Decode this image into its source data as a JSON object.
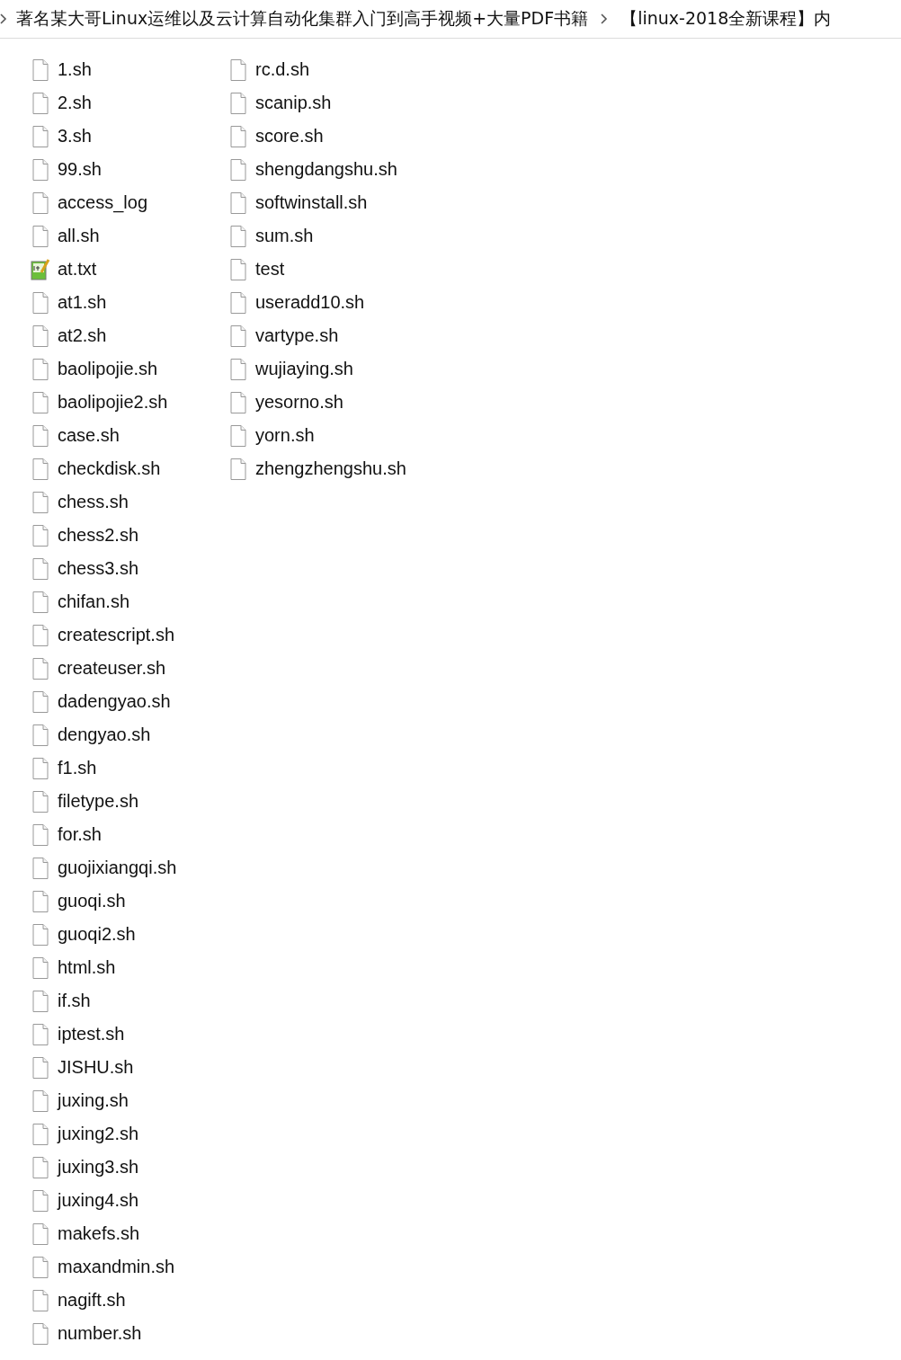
{
  "breadcrumb": [
    "著名某大哥Linux运维以及云计算自动化集群入门到高手视频+大量PDF书籍",
    "【linux-2018全新课程】内"
  ],
  "file_columns": [
    [
      {
        "name": "1.sh",
        "kind": "file"
      },
      {
        "name": "2.sh",
        "kind": "file"
      },
      {
        "name": "3.sh",
        "kind": "file"
      },
      {
        "name": "99.sh",
        "kind": "file"
      },
      {
        "name": "access_log",
        "kind": "file"
      },
      {
        "name": "all.sh",
        "kind": "file"
      },
      {
        "name": "at.txt",
        "kind": "text"
      },
      {
        "name": "at1.sh",
        "kind": "file"
      },
      {
        "name": "at2.sh",
        "kind": "file"
      },
      {
        "name": "baolipojie.sh",
        "kind": "file"
      },
      {
        "name": "baolipojie2.sh",
        "kind": "file"
      },
      {
        "name": "case.sh",
        "kind": "file"
      },
      {
        "name": "checkdisk.sh",
        "kind": "file"
      },
      {
        "name": "chess.sh",
        "kind": "file"
      },
      {
        "name": "chess2.sh",
        "kind": "file"
      },
      {
        "name": "chess3.sh",
        "kind": "file"
      },
      {
        "name": "chifan.sh",
        "kind": "file"
      },
      {
        "name": "createscript.sh",
        "kind": "file"
      },
      {
        "name": "createuser.sh",
        "kind": "file"
      },
      {
        "name": "dadengyao.sh",
        "kind": "file"
      },
      {
        "name": "dengyao.sh",
        "kind": "file"
      },
      {
        "name": "f1.sh",
        "kind": "file"
      },
      {
        "name": "filetype.sh",
        "kind": "file"
      },
      {
        "name": "for.sh",
        "kind": "file"
      },
      {
        "name": "guojixiangqi.sh",
        "kind": "file"
      },
      {
        "name": "guoqi.sh",
        "kind": "file"
      },
      {
        "name": "guoqi2.sh",
        "kind": "file"
      },
      {
        "name": "html.sh",
        "kind": "file"
      },
      {
        "name": "if.sh",
        "kind": "file"
      },
      {
        "name": "iptest.sh",
        "kind": "file"
      },
      {
        "name": "JISHU.sh",
        "kind": "file"
      },
      {
        "name": "juxing.sh",
        "kind": "file"
      },
      {
        "name": "juxing2.sh",
        "kind": "file"
      },
      {
        "name": "juxing3.sh",
        "kind": "file"
      },
      {
        "name": "juxing4.sh",
        "kind": "file"
      },
      {
        "name": "makefs.sh",
        "kind": "file"
      },
      {
        "name": "maxandmin.sh",
        "kind": "file"
      },
      {
        "name": "nagift.sh",
        "kind": "file"
      },
      {
        "name": "number.sh",
        "kind": "file"
      }
    ],
    [
      {
        "name": "rc.d.sh",
        "kind": "file"
      },
      {
        "name": "scanip.sh",
        "kind": "file"
      },
      {
        "name": "score.sh",
        "kind": "file"
      },
      {
        "name": "shengdangshu.sh",
        "kind": "file"
      },
      {
        "name": "softwinstall.sh",
        "kind": "file"
      },
      {
        "name": "sum.sh",
        "kind": "file"
      },
      {
        "name": "test",
        "kind": "file"
      },
      {
        "name": "useradd10.sh",
        "kind": "file"
      },
      {
        "name": "vartype.sh",
        "kind": "file"
      },
      {
        "name": "wujiaying.sh",
        "kind": "file"
      },
      {
        "name": "yesorno.sh",
        "kind": "file"
      },
      {
        "name": "yorn.sh",
        "kind": "file"
      },
      {
        "name": "zhengzhengshu.sh",
        "kind": "file"
      }
    ]
  ]
}
